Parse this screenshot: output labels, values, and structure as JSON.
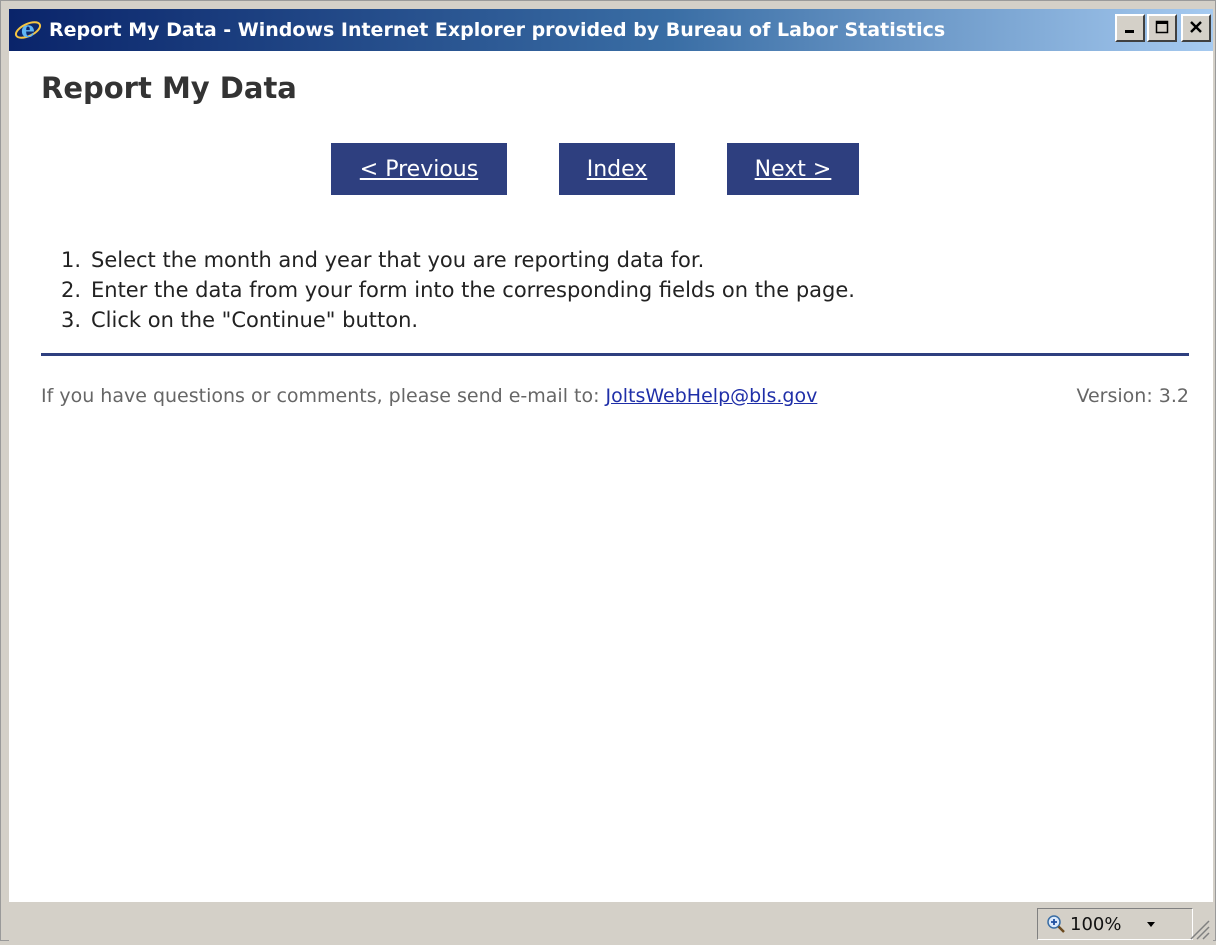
{
  "window": {
    "title": "Report My Data - Windows Internet Explorer provided by Bureau of Labor Statistics",
    "icon": "ie-icon",
    "controls": [
      "minimize-icon",
      "maximize-icon",
      "close-icon"
    ]
  },
  "page": {
    "title": "Report My Data",
    "nav": {
      "previous_label": "< Previous",
      "index_label": "Index",
      "next_label": "Next >"
    },
    "steps": [
      {
        "num": "1.",
        "text": "Select the month and year that you are reporting data for."
      },
      {
        "num": "2.",
        "text": "Enter the data from your form into the corresponding fields on the page."
      },
      {
        "num": "3.",
        "text": "Click on the \"Continue\" button."
      }
    ],
    "footer": {
      "text": "If you have questions or comments, please send e-mail to: ",
      "email": "JoltsWebHelp@bls.gov",
      "version": "Version: 3.2"
    }
  },
  "statusbar": {
    "zoom_level": "100%",
    "zoom_icon": "zoom-magnifier-icon"
  },
  "colors": {
    "nav_button_bg": "#2e3f7f",
    "divider": "#2e3f7f",
    "link": "#1f2fa8",
    "titlebar_start": "#0a246a"
  }
}
